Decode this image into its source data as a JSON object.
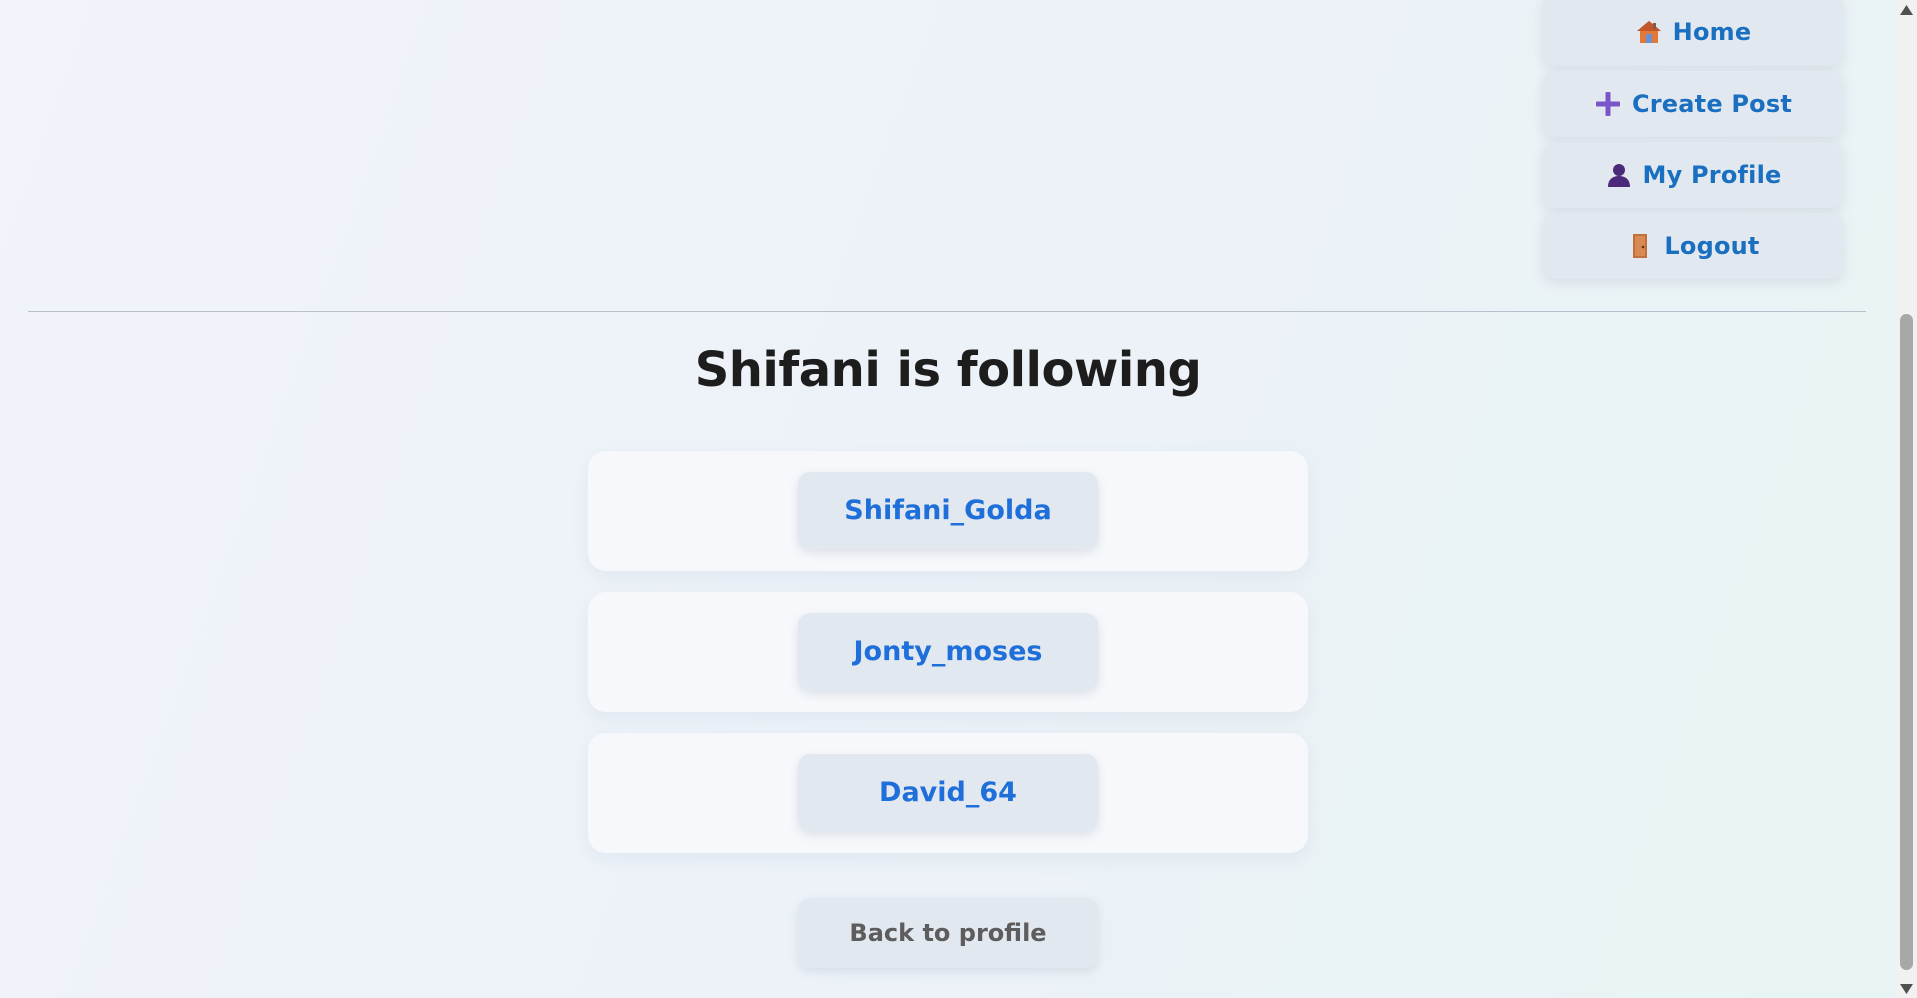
{
  "nav": {
    "home": {
      "label": "Home",
      "icon": "house-icon"
    },
    "create_post": {
      "label": "Create Post",
      "icon": "plus-icon"
    },
    "my_profile": {
      "label": "My Profile",
      "icon": "person-icon"
    },
    "logout": {
      "label": "Logout",
      "icon": "door-icon"
    }
  },
  "page": {
    "title": "Shifani is following"
  },
  "following": [
    {
      "username": "Shifani_Golda"
    },
    {
      "username": "Jonty_moses"
    },
    {
      "username": "David_64"
    }
  ],
  "actions": {
    "back_label": "Back to profile"
  },
  "colors": {
    "link": "#1e6fd9",
    "nav_text": "#1a6fc0",
    "button_bg": "#e2e8f0",
    "card_bg": "#f6f8fb",
    "title": "#1d1d1d"
  }
}
